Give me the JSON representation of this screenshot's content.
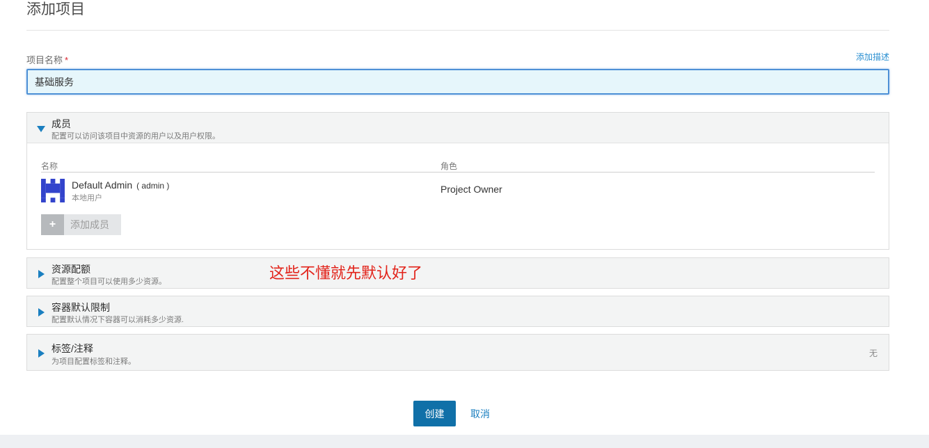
{
  "page": {
    "title": "添加项目"
  },
  "project_name": {
    "label": "项目名称",
    "required_mark": "*",
    "value": "基础服务",
    "add_description": "添加描述"
  },
  "members": {
    "title": "成员",
    "subtitle": "配置可以访问该项目中资源的用户以及用户权限。",
    "columns": {
      "name": "名称",
      "role": "角色"
    },
    "rows": [
      {
        "name": "Default Admin",
        "username": "( admin )",
        "type": "本地用户",
        "role": "Project Owner"
      }
    ],
    "add_button": "添加成员"
  },
  "sections": {
    "quota": {
      "title": "资源配额",
      "subtitle": "配置整个项目可以使用多少资源。"
    },
    "container_limits": {
      "title": "容器默认限制",
      "subtitle": "配置默认情况下容器可以消耗多少资源."
    },
    "labels": {
      "title": "标签/注释",
      "subtitle": "为项目配置标签和注释。",
      "value": "无"
    }
  },
  "annotation": "这些不懂就先默认好了",
  "actions": {
    "create": "创建",
    "cancel": "取消"
  },
  "colors": {
    "accent": "#1070a8",
    "link": "#2a8fd1",
    "annotation": "#e2231a",
    "avatar": "#3344cc"
  },
  "icons": {
    "expanded": "triangle-down-icon",
    "collapsed": "triangle-right-icon",
    "add": "plus-icon"
  }
}
